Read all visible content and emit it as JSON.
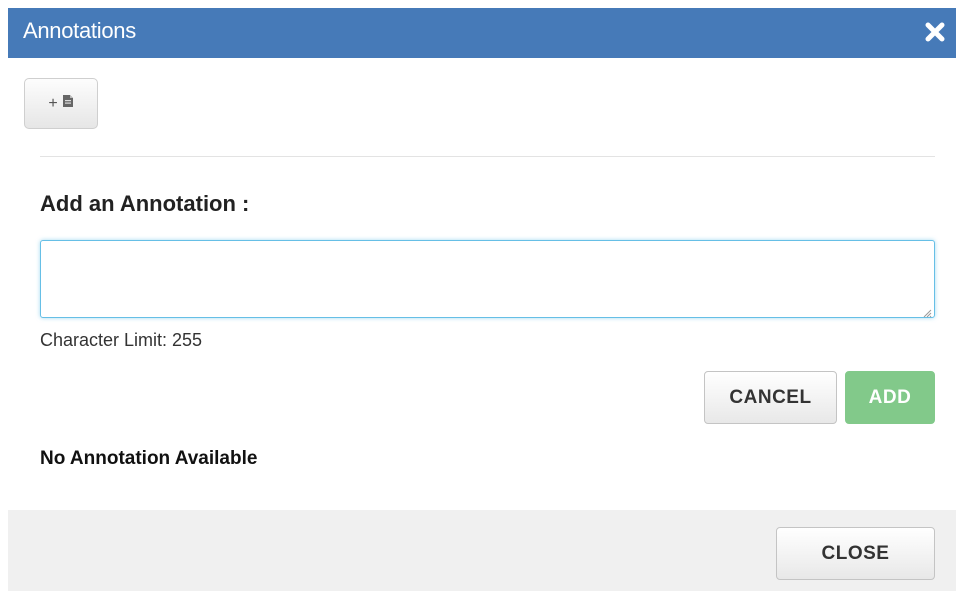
{
  "dialog": {
    "title": "Annotations",
    "close_icon": "close-x-icon",
    "add_document_button": {
      "plus_glyph": "+",
      "icon": "document-icon"
    },
    "add_section": {
      "label": "Add an Annotation :",
      "input_value": "",
      "input_placeholder": "",
      "char_limit_text": "Character Limit: 255"
    },
    "buttons": {
      "cancel_label": "CANCEL",
      "add_label": "ADD",
      "close_label": "CLOSE"
    },
    "empty_state_text": "No Annotation Available"
  },
  "colors": {
    "titlebar": "#467ab8",
    "add_button": "#82c98a",
    "input_focus_border": "#66bfe6",
    "footer_bg": "#f0f0f0"
  }
}
